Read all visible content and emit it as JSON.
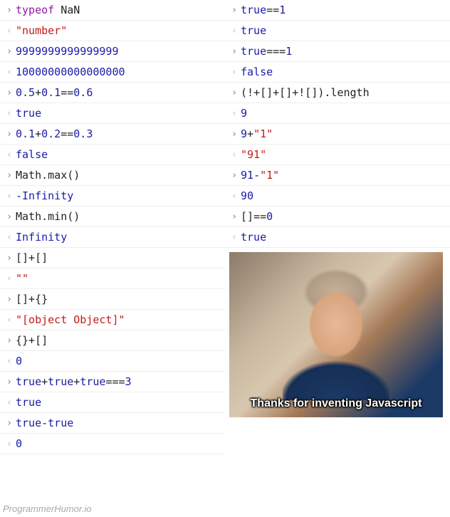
{
  "left": [
    {
      "dir": "in",
      "tokens": [
        {
          "t": "typeof ",
          "c": "tok-keyword"
        },
        {
          "t": "NaN",
          "c": "tok-ident"
        }
      ]
    },
    {
      "dir": "out",
      "tokens": [
        {
          "t": "\"number\"",
          "c": "tok-string"
        }
      ]
    },
    {
      "dir": "in",
      "tokens": [
        {
          "t": "9999999999999999",
          "c": "tok-number"
        }
      ]
    },
    {
      "dir": "out",
      "tokens": [
        {
          "t": "10000000000000000",
          "c": "tok-number"
        }
      ]
    },
    {
      "dir": "in",
      "tokens": [
        {
          "t": "0.5",
          "c": "tok-number"
        },
        {
          "t": "+",
          "c": "tok-op"
        },
        {
          "t": "0.1",
          "c": "tok-number"
        },
        {
          "t": "==",
          "c": "tok-op"
        },
        {
          "t": "0.6",
          "c": "tok-number"
        }
      ]
    },
    {
      "dir": "out",
      "tokens": [
        {
          "t": "true",
          "c": "tok-bool"
        }
      ]
    },
    {
      "dir": "in",
      "tokens": [
        {
          "t": "0.1",
          "c": "tok-number"
        },
        {
          "t": "+",
          "c": "tok-op"
        },
        {
          "t": "0.2",
          "c": "tok-number"
        },
        {
          "t": "==",
          "c": "tok-op"
        },
        {
          "t": "0.3",
          "c": "tok-number"
        }
      ]
    },
    {
      "dir": "out",
      "tokens": [
        {
          "t": "false",
          "c": "tok-bool"
        }
      ]
    },
    {
      "dir": "in",
      "tokens": [
        {
          "t": "Math",
          "c": "tok-ident"
        },
        {
          "t": ".max()",
          "c": "tok-op"
        }
      ]
    },
    {
      "dir": "out",
      "tokens": [
        {
          "t": "-Infinity",
          "c": "tok-infinity"
        }
      ]
    },
    {
      "dir": "in",
      "tokens": [
        {
          "t": "Math",
          "c": "tok-ident"
        },
        {
          "t": ".min()",
          "c": "tok-op"
        }
      ]
    },
    {
      "dir": "out",
      "tokens": [
        {
          "t": "Infinity",
          "c": "tok-infinity"
        }
      ]
    },
    {
      "dir": "in",
      "tokens": [
        {
          "t": "[]+[]",
          "c": "tok-op"
        }
      ]
    },
    {
      "dir": "out",
      "tokens": [
        {
          "t": "\"\"",
          "c": "tok-string"
        }
      ]
    },
    {
      "dir": "in",
      "tokens": [
        {
          "t": "[]+{}",
          "c": "tok-op"
        }
      ]
    },
    {
      "dir": "out",
      "tokens": [
        {
          "t": "\"[object Object]\"",
          "c": "tok-string"
        }
      ]
    },
    {
      "dir": "in",
      "tokens": [
        {
          "t": "{}+[]",
          "c": "tok-op"
        }
      ]
    },
    {
      "dir": "out",
      "tokens": [
        {
          "t": "0",
          "c": "tok-number"
        }
      ]
    },
    {
      "dir": "in",
      "tokens": [
        {
          "t": "true",
          "c": "tok-bool"
        },
        {
          "t": "+",
          "c": "tok-op"
        },
        {
          "t": "true",
          "c": "tok-bool"
        },
        {
          "t": "+",
          "c": "tok-op"
        },
        {
          "t": "true",
          "c": "tok-bool"
        },
        {
          "t": "===",
          "c": "tok-op"
        },
        {
          "t": "3",
          "c": "tok-number"
        }
      ]
    },
    {
      "dir": "out",
      "tokens": [
        {
          "t": "true",
          "c": "tok-bool"
        }
      ]
    },
    {
      "dir": "in",
      "tokens": [
        {
          "t": "true",
          "c": "tok-bool"
        },
        {
          "t": "-",
          "c": "tok-op"
        },
        {
          "t": "true",
          "c": "tok-bool"
        }
      ]
    },
    {
      "dir": "out",
      "tokens": [
        {
          "t": "0",
          "c": "tok-number"
        }
      ]
    }
  ],
  "right": [
    {
      "dir": "in",
      "tokens": [
        {
          "t": "true",
          "c": "tok-bool"
        },
        {
          "t": "==",
          "c": "tok-op"
        },
        {
          "t": "1",
          "c": "tok-number"
        }
      ]
    },
    {
      "dir": "out",
      "tokens": [
        {
          "t": "true",
          "c": "tok-bool"
        }
      ]
    },
    {
      "dir": "in",
      "tokens": [
        {
          "t": "true",
          "c": "tok-bool"
        },
        {
          "t": "===",
          "c": "tok-op"
        },
        {
          "t": "1",
          "c": "tok-number"
        }
      ]
    },
    {
      "dir": "out",
      "tokens": [
        {
          "t": "false",
          "c": "tok-bool"
        }
      ]
    },
    {
      "dir": "in",
      "tokens": [
        {
          "t": "(!+[]+[]+![]).length",
          "c": "tok-op"
        }
      ]
    },
    {
      "dir": "out",
      "tokens": [
        {
          "t": "9",
          "c": "tok-number"
        }
      ]
    },
    {
      "dir": "in",
      "tokens": [
        {
          "t": "9",
          "c": "tok-number"
        },
        {
          "t": "+",
          "c": "tok-op"
        },
        {
          "t": "\"1\"",
          "c": "tok-string"
        }
      ]
    },
    {
      "dir": "out",
      "tokens": [
        {
          "t": "\"91\"",
          "c": "tok-string"
        }
      ]
    },
    {
      "dir": "in",
      "tokens": [
        {
          "t": "91",
          "c": "tok-number"
        },
        {
          "t": "-",
          "c": "tok-op"
        },
        {
          "t": "\"1\"",
          "c": "tok-string"
        }
      ]
    },
    {
      "dir": "out",
      "tokens": [
        {
          "t": "90",
          "c": "tok-number"
        }
      ]
    },
    {
      "dir": "in",
      "tokens": [
        {
          "t": "[]==",
          "c": "tok-op"
        },
        {
          "t": "0",
          "c": "tok-number"
        }
      ]
    },
    {
      "dir": "out",
      "tokens": [
        {
          "t": "true",
          "c": "tok-bool"
        }
      ]
    }
  ],
  "arrows": {
    "in": "›",
    "out": "‹"
  },
  "meme_caption": "Thanks for inventing Javascript",
  "watermark": "ProgrammerHumor.io"
}
